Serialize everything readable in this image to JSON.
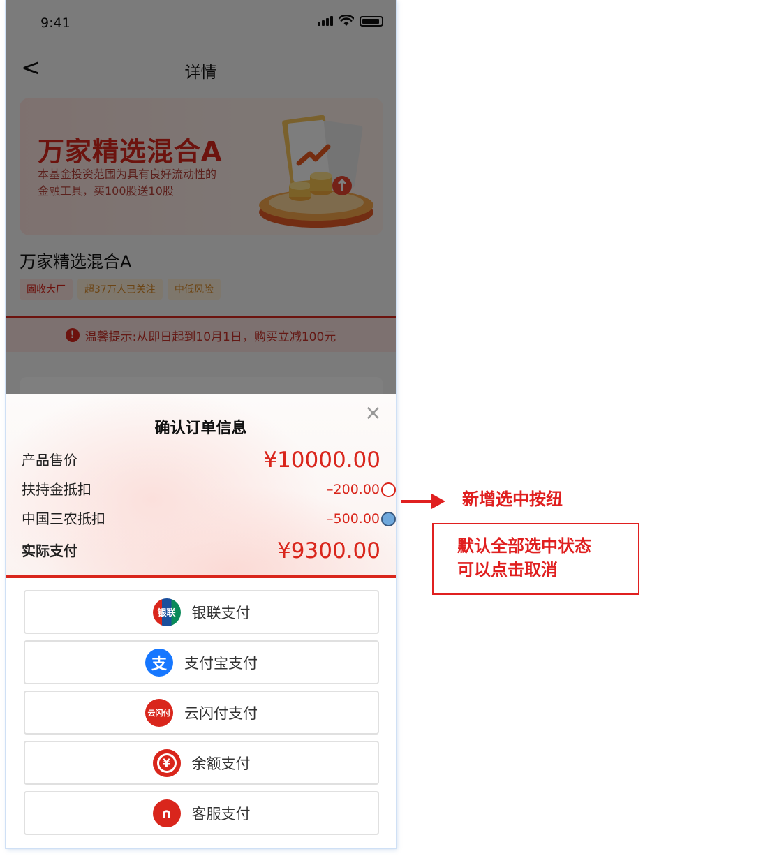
{
  "status_bar": {
    "time": "9:41"
  },
  "nav": {
    "back_glyph": "<",
    "title": "详情"
  },
  "banner": {
    "title": "万家精选混合A",
    "desc": "本基金投资范围为具有良好流动性的金融工具，买100股送10股"
  },
  "product": {
    "name": "万家精选混合A",
    "tags": [
      "固收大厂",
      "超37万人已关注",
      "中低风险"
    ]
  },
  "notice": {
    "icon": "!",
    "text": "温馨提示:从即日起到10月1日，购买立减100元"
  },
  "sheet": {
    "title": "确认订单信息",
    "close_glyph": "×",
    "rows": [
      {
        "label": "产品售价",
        "value": "¥10000.00"
      },
      {
        "label": "扶持金抵扣",
        "value": "–200.00",
        "checked": false
      },
      {
        "label": "中国三农抵扣",
        "value": "–500.00",
        "checked": true
      },
      {
        "label": "实际支付",
        "value": "¥9300.00"
      }
    ],
    "payments": [
      {
        "label": "银联支付",
        "icon": "unionpay-icon",
        "icon_text": "银联",
        "color": "#d9261c"
      },
      {
        "label": "支付宝支付",
        "icon": "alipay-icon",
        "icon_text": "支",
        "color": "#1677ff"
      },
      {
        "label": "云闪付支付",
        "icon": "quickpass-icon",
        "icon_text": "云闪付",
        "color": "#d9261c"
      },
      {
        "label": "余额支付",
        "icon": "balance-yuan-icon",
        "icon_text": "¥",
        "color": "#d9261c"
      },
      {
        "label": "客服支付",
        "icon": "headset-icon",
        "icon_text": "∩",
        "color": "#d9261c"
      }
    ]
  },
  "annotations": {
    "arrow_note": "新增选中按纽",
    "box_line1": "默认全部选中状态",
    "box_line2": "可以点击取消"
  },
  "colors": {
    "accent": "#d9261c",
    "annotation": "#e02020",
    "checked_radio": "#6fa8dc"
  }
}
